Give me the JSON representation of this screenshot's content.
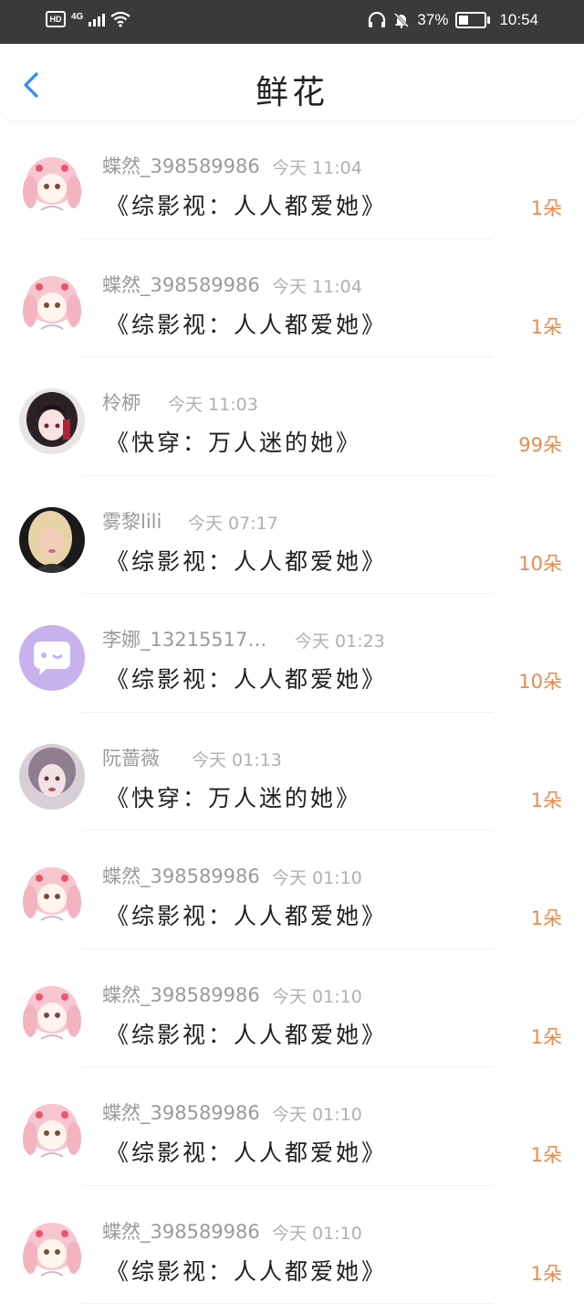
{
  "status_bar": {
    "hd": "HD",
    "network": "4G",
    "battery": "37%",
    "time": "10:54"
  },
  "header": {
    "title": "鲜花"
  },
  "icons": {
    "back": "chevron-left-icon",
    "headphones": "headphones-icon",
    "mute": "bell-off-icon",
    "wifi": "wifi-icon"
  },
  "colors": {
    "accent": "#2d8cf0",
    "amount": "#e88b4e",
    "status_bg": "#3a3a3c"
  },
  "items": [
    {
      "name": "蝶然_398589986",
      "time": "今天 11:04",
      "book": "《综影视：人人都爱她》",
      "amount": "1朵",
      "avatar": "pink-anime-girl"
    },
    {
      "name": "蝶然_398589986",
      "time": "今天 11:04",
      "book": "《综影视：人人都爱她》",
      "amount": "1朵",
      "avatar": "pink-anime-girl"
    },
    {
      "name": "柃桺",
      "time": "今天 11:03",
      "book": "《快穿：万人迷的她》",
      "amount": "99朵",
      "avatar": "dark-anime-girl"
    },
    {
      "name": "雾黎lili",
      "time": "今天 07:17",
      "book": "《综影视：人人都爱她》",
      "amount": "10朵",
      "avatar": "photo-blonde-girl"
    },
    {
      "name": "李娜_13215517…",
      "time": "今天 01:23",
      "book": "《综影视：人人都爱她》",
      "amount": "10朵",
      "avatar": "default-chat-bubble"
    },
    {
      "name": "阮蔷薇",
      "time": "今天 01:13",
      "book": "《快穿：万人迷的她》",
      "amount": "1朵",
      "avatar": "painted-girl"
    },
    {
      "name": "蝶然_398589986",
      "time": "今天 01:10",
      "book": "《综影视：人人都爱她》",
      "amount": "1朵",
      "avatar": "pink-anime-girl"
    },
    {
      "name": "蝶然_398589986",
      "time": "今天 01:10",
      "book": "《综影视：人人都爱她》",
      "amount": "1朵",
      "avatar": "pink-anime-girl"
    },
    {
      "name": "蝶然_398589986",
      "time": "今天 01:10",
      "book": "《综影视：人人都爱她》",
      "amount": "1朵",
      "avatar": "pink-anime-girl"
    },
    {
      "name": "蝶然_398589986",
      "time": "今天 01:10",
      "book": "《综影视：人人都爱她》",
      "amount": "1朵",
      "avatar": "pink-anime-girl"
    }
  ]
}
